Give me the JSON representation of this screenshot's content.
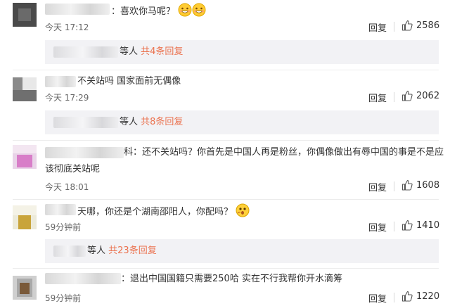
{
  "comments": [
    {
      "text": "：喜欢你马呢？",
      "time": "今天 17:12",
      "reply_label": "回复",
      "likes": "2586",
      "emoji_icons": [
        "grin-face-icon",
        "grin-face-icon"
      ],
      "sub": {
        "who": "等人",
        "count": "共4条回复"
      }
    },
    {
      "text": "不关站吗 国家面前无偶像",
      "time": "今天 17:29",
      "reply_label": "回复",
      "likes": "2062",
      "sub": {
        "who": "等人",
        "count": "共8条回复"
      }
    },
    {
      "text_line1": "科：还不关站吗？你首先是中国人再是粉丝，你偶像做出有辱中国的事是不是应",
      "text_line2": "该彻底关站呢",
      "time": "今天 18:01",
      "reply_label": "回复",
      "likes": "1608"
    },
    {
      "text": "天哪，你还是个湖南邵阳人，你配吗？",
      "time": "59分钟前",
      "reply_label": "回复",
      "likes": "1410",
      "emoji_icons": [
        "thinking-face-icon"
      ],
      "sub": {
        "who": "等人",
        "count": "共23条回复"
      }
    },
    {
      "text": "：退出中国国籍只需要250哈 实在不行我帮你开水滴筹",
      "time": "59分钟前",
      "reply_label": "回复",
      "likes": "1220"
    }
  ],
  "colors": {
    "accent": "#eb7350",
    "sub_bg": "#f2f2f5",
    "meta_text": "#666666"
  },
  "icons": {
    "like": "thumbs-up-icon"
  }
}
